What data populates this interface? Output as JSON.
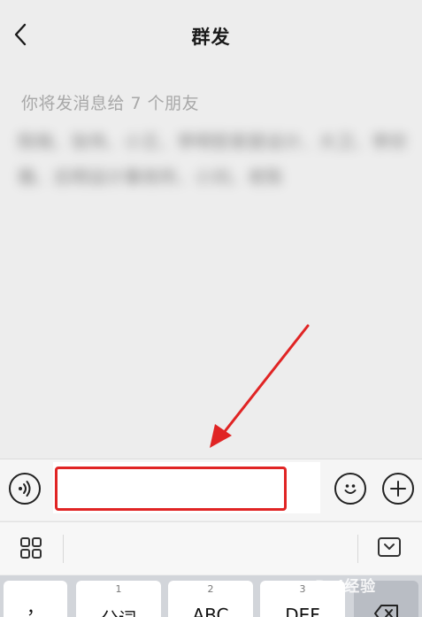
{
  "header": {
    "title": "群发"
  },
  "hint": "你将发消息给 7 个朋友",
  "recipients": "陈晓、张伟、小王、李明哲家居设计、大卫、李欣雅、志明设计事务所、小刘、老陈",
  "input": {
    "value": "",
    "placeholder": ""
  },
  "keyboard": {
    "keys": [
      {
        "num": "",
        "label": "，"
      },
      {
        "num": "1",
        "label": "分词"
      },
      {
        "num": "2",
        "label": "ABC"
      },
      {
        "num": "3",
        "label": "DEF"
      },
      {
        "num": "",
        "label": ""
      }
    ]
  },
  "watermark": "Bai经验",
  "colors": {
    "annotation": "#e02424",
    "background": "#ededed"
  }
}
